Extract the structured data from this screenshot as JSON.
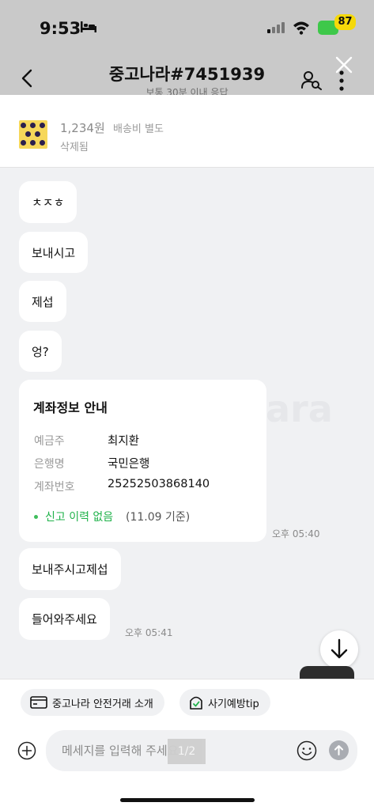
{
  "status_bar": {
    "time": "9:53",
    "battery": "87"
  },
  "header": {
    "title": "중고나라#7451939",
    "subtitle": "보통 30분 이내 응답"
  },
  "product": {
    "price": "1,234원",
    "shipping": "배송비 별도",
    "state": "삭제됨"
  },
  "messages": [
    {
      "text": "ㅊㅈㅎ"
    },
    {
      "text": "보내시고"
    },
    {
      "text": "제섭"
    },
    {
      "text": "엉?"
    }
  ],
  "account_card": {
    "title": "계좌정보 안내",
    "rows": [
      {
        "label": "예금주",
        "value": "최지환"
      },
      {
        "label": "은행명",
        "value": "국민은행"
      },
      {
        "label": "계좌번호",
        "value": "25252503868140"
      }
    ],
    "report_status": "신고 이력 없음",
    "report_date": "(11.09 기준)",
    "time": "오후 05:40"
  },
  "messages_after": [
    {
      "text": "보내주시고제섭"
    },
    {
      "text": "들어와주세요",
      "time": "오후 05:41"
    }
  ],
  "watermark": "ara",
  "chips": [
    {
      "label": "중고나라 안전거래 소개"
    },
    {
      "label": "사기예방tip"
    }
  ],
  "input": {
    "placeholder": "메세지를 입력해 주세요."
  },
  "page_indicator": "1/2",
  "colors": {
    "accent_green": "#1fb24a",
    "battery": "#3ec84a",
    "badge": "#f5d90a"
  }
}
